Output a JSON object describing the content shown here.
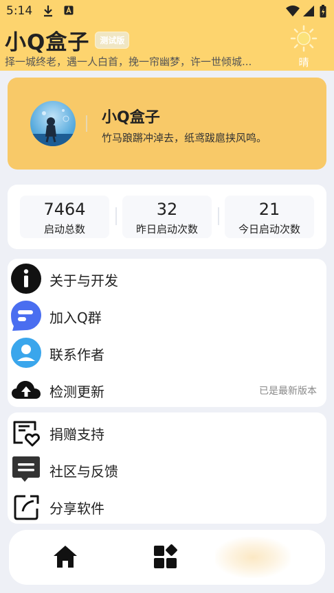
{
  "status": {
    "time": "5:14",
    "icons": [
      "download-icon",
      "a-notification-icon",
      "wifi-icon",
      "signal-icon",
      "battery-icon"
    ]
  },
  "header": {
    "title": "小Q盒子",
    "badge": "测试版",
    "subtitle": "择一城终老，遇一人白首，挽一帘幽梦，许一世倾城...",
    "weather": "晴",
    "weather_icon": "sun-icon"
  },
  "profile": {
    "name": "小Q盒子",
    "signature": "竹马踉蹡冲淖去，纸鸢跋扈挟风鸣。"
  },
  "stats": [
    {
      "value": "7464",
      "label": "启动总数"
    },
    {
      "value": "32",
      "label": "昨日启动次数"
    },
    {
      "value": "21",
      "label": "今日启动次数"
    }
  ],
  "menu1": [
    {
      "label": "关于与开发",
      "icon": "info-icon"
    },
    {
      "label": "加入Q群",
      "icon": "chat-bubble-icon"
    },
    {
      "label": "联系作者",
      "icon": "user-icon"
    },
    {
      "label": "检测更新",
      "icon": "cloud-upload-icon",
      "extra": "已是最新版本"
    }
  ],
  "menu2": [
    {
      "label": "捐赠支持",
      "icon": "donate-icon"
    },
    {
      "label": "社区与反馈",
      "icon": "message-icon"
    },
    {
      "label": "分享软件",
      "icon": "share-icon"
    }
  ],
  "nav": [
    {
      "icon": "home-icon"
    },
    {
      "icon": "apps-grid-icon"
    }
  ],
  "colors": {
    "header_bg": "#fdd46e",
    "card_bg": "#f8c968",
    "page_bg": "#eef0f6"
  }
}
